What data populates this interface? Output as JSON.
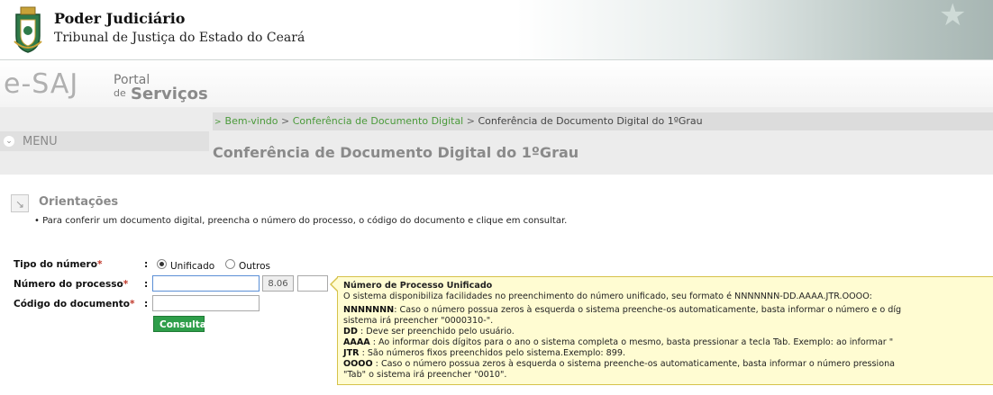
{
  "header": {
    "org_name": "Poder Judiciário",
    "org_sub": "Tribunal de Justiça do Estado do Ceará"
  },
  "brand": {
    "logo": "e-SAJ",
    "portal_line1": "Portal",
    "portal_line2": "de",
    "portal_line3": "Serviços"
  },
  "breadcrumb": {
    "items": [
      "Bem-vindo",
      "Conferência de Documento Digital",
      "Conferência de Documento Digital do 1ºGrau"
    ],
    "separator": ">"
  },
  "menu": {
    "label": "MENU"
  },
  "page": {
    "title": "Conferência de Documento Digital do 1ºGrau"
  },
  "orientacoes": {
    "title": "Orientações",
    "text": "•  Para conferir um documento digital, preencha o número do processo, o código do documento e clique em consultar."
  },
  "form": {
    "tipo_label": "Tipo do número",
    "processo_label": "Número do processo",
    "codigo_label": "Código do documento",
    "required_mark": "*",
    "colon": ":",
    "radio_unificado": "Unificado",
    "radio_outros": "Outros",
    "radio_selected": "Unificado",
    "processo_value": "",
    "foro_value": "8.06",
    "origem_value": "",
    "codigo_value": "",
    "submit_label": "Consultar"
  },
  "tooltip": {
    "title": "Número de Processo Unificado",
    "intro": "O sistema disponibiliza facilidades no preenchimento do número unificado, seu formato é NNNNNNN-DD.AAAA.JTR.OOOO:",
    "n_key": "NNNNNNN",
    "n_text": ": Caso o número possua zeros à esquerda o sistema preenche-os automaticamente, basta informar o número e o díg",
    "n_text2": "sistema irá preencher \"0000310-\".",
    "dd_key": "DD",
    "dd_text": " : Deve ser preenchido pelo usuário.",
    "aaaa_key": "AAAA",
    "aaaa_text": " : Ao informar dois dígitos para o ano o sistema completa o mesmo, basta pressionar a tecla Tab. Exemplo: ao informar \"",
    "jtr_key": "JTR",
    "jtr_text": " : São números fixos preenchidos pelo sistema.Exemplo: 899.",
    "oooo_key": "OOOO",
    "oooo_text": " : Caso o número possua zeros à esquerda o sistema preenche-os automaticamente, basta informar o número pressiona",
    "oooo_text2": "\"Tab\" o sistema irá preencher \"0010\"."
  },
  "colors": {
    "accent_green": "#2e9e4a",
    "link_green": "#4a9a3a",
    "tooltip_bg": "#fffcd2",
    "required_red": "#c0392b"
  }
}
